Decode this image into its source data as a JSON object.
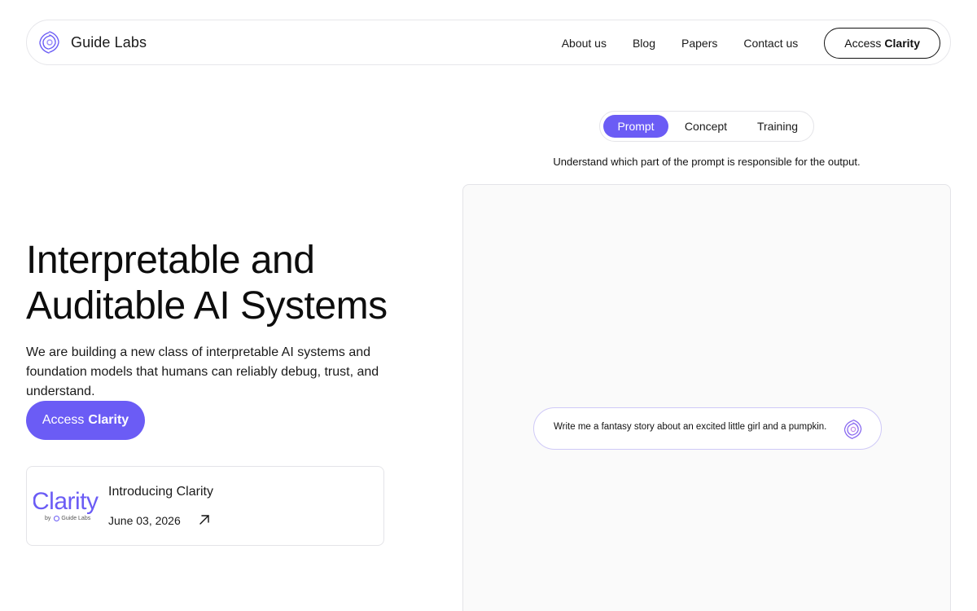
{
  "brand": {
    "name": "Guide Labs",
    "logo_icon": "spiral-logo-icon",
    "accent": "#6b5cf5"
  },
  "nav": {
    "links": [
      "About us",
      "Blog",
      "Papers",
      "Contact us"
    ],
    "cta": {
      "prefix": "Access",
      "emphasis": "Clarity"
    }
  },
  "hero": {
    "title_line1": "Interpretable and",
    "title_line2": "Auditable AI Systems",
    "description": "We are building a new class of interpretable AI systems and foundation models that humans can reliably debug, trust, and understand.",
    "cta": {
      "prefix": "Access",
      "emphasis": "Clarity"
    }
  },
  "news_card": {
    "logo_word": "Clarity",
    "logo_by": "by",
    "logo_brand": "Guide Labs",
    "title": "Introducing Clarity",
    "date": "June 03, 2026",
    "arrow_icon": "arrow-up-right-icon"
  },
  "demo": {
    "tabs": [
      "Prompt",
      "Concept",
      "Training"
    ],
    "active_tab": "Prompt",
    "caption": "Understand which part of the prompt is responsible for the output.",
    "prompt_text": "Write me a fantasy story about an excited little girl and a pumpkin.",
    "prompt_icon": "spiral-logo-icon"
  }
}
